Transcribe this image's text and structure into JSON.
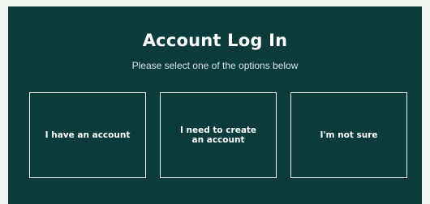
{
  "header": {
    "title": "Account Log In",
    "subtitle": "Please select one of the options below"
  },
  "options": [
    {
      "label": "I have an account"
    },
    {
      "label": "I need to create an account"
    },
    {
      "label": "I'm not sure"
    }
  ],
  "colors": {
    "page_background": "#eef5ee",
    "panel_background": "#0b3b3a",
    "text": "#ffffff",
    "border": "#ffffff"
  }
}
